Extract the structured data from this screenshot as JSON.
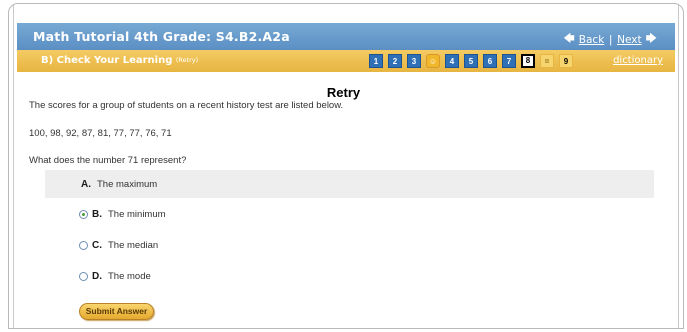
{
  "header": {
    "title": "Math Tutorial 4th Grade: S4.B2.A2a",
    "back_label": "Back",
    "separator": "|",
    "next_label": "Next"
  },
  "section": {
    "label": "B) Check Your Learning",
    "retry_tag": "(Retry)",
    "pages": [
      "1",
      "2",
      "3",
      "☺",
      "4",
      "5",
      "6",
      "7",
      "8",
      "=",
      "9"
    ],
    "current_page": "8",
    "dictionary_label": "dictionary"
  },
  "content": {
    "heading": "Retry",
    "intro": "The scores for a group of students on a recent history test are listed below.",
    "scores": "100, 98, 92, 87, 81, 77, 77, 76, 71",
    "question": "What does the number 71 represent?",
    "choices": [
      {
        "letter": "A.",
        "text": "The maximum"
      },
      {
        "letter": "B.",
        "text": "The minimum"
      },
      {
        "letter": "C.",
        "text": "The median"
      },
      {
        "letter": "D.",
        "text": "The mode"
      }
    ],
    "selected_choice": "B",
    "submit_label": "Submit Answer"
  }
}
